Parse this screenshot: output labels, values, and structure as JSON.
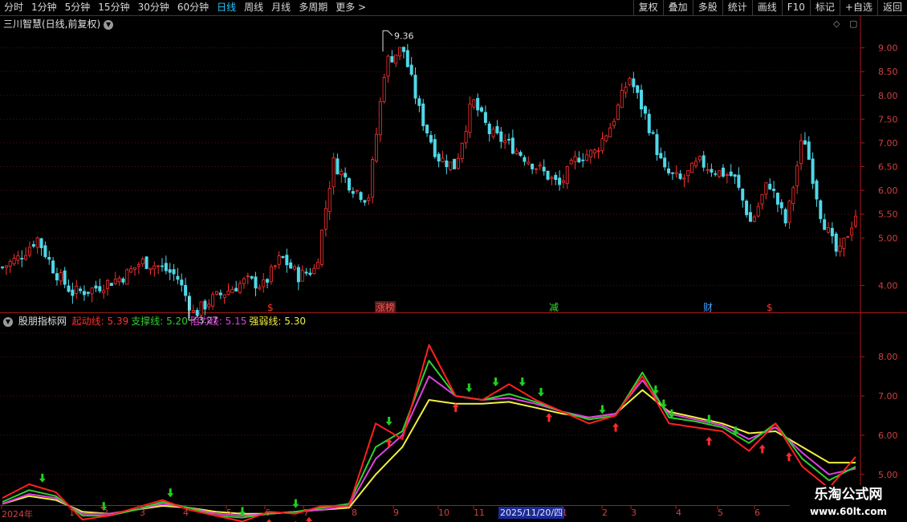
{
  "toolbar": {
    "periods": [
      {
        "label": "分时"
      },
      {
        "label": "1分钟"
      },
      {
        "label": "5分钟"
      },
      {
        "label": "15分钟"
      },
      {
        "label": "30分钟"
      },
      {
        "label": "60分钟"
      },
      {
        "label": "日线"
      },
      {
        "label": "周线"
      },
      {
        "label": "月线"
      },
      {
        "label": "多周期"
      },
      {
        "label": "更多 >"
      }
    ],
    "active_period": "日线",
    "tools": [
      {
        "label": "复权"
      },
      {
        "label": "叠加"
      },
      {
        "label": "多股"
      },
      {
        "label": "统计"
      },
      {
        "label": "画线"
      },
      {
        "label": "F10"
      },
      {
        "label": "标记"
      },
      {
        "label": "+自选"
      },
      {
        "label": "返回"
      }
    ]
  },
  "stock": {
    "title": "三川智慧(日线,前复权)",
    "dropdown_icon": "chevron-down-icon"
  },
  "chart_data": [
    {
      "type": "candlestick",
      "title": "三川智慧(日线,前复权)",
      "y_ticks": [
        "9.00",
        "8.50",
        "8.00",
        "7.50",
        "7.00",
        "6.50",
        "6.00",
        "5.50",
        "5.00",
        "4.00"
      ],
      "ylim": [
        3.5,
        9.5
      ],
      "annotations": [
        {
          "label": "9.36",
          "kind": "high",
          "value": 9.36
        },
        {
          "label": "3.27",
          "kind": "low",
          "value": 3.27
        }
      ],
      "event_markers": [
        {
          "label": "$",
          "color": "#ff3030"
        },
        {
          "label": "涨榜",
          "color": "#ff5050"
        },
        {
          "label": "减",
          "color": "#30e030"
        },
        {
          "label": "财",
          "color": "#40a0ff"
        },
        {
          "label": "$",
          "color": "#ff3030"
        }
      ],
      "colors": {
        "up": "#ff3030",
        "down": "#50d8e8"
      },
      "closes": [
        4.38,
        4.6,
        5.0,
        4.3,
        3.85,
        3.9,
        4.05,
        4.2,
        4.5,
        4.4,
        4.2,
        3.4,
        3.7,
        3.9,
        4.1,
        4.0,
        4.6,
        4.2,
        4.35,
        6.6,
        6.1,
        5.8,
        8.7,
        9.0,
        7.6,
        6.7,
        6.5,
        7.9,
        7.2,
        7.0,
        6.7,
        6.4,
        6.1,
        6.7,
        6.8,
        7.4,
        8.4,
        7.5,
        6.4,
        6.2,
        6.6,
        6.4,
        6.3,
        5.3,
        6.2,
        5.3,
        7.2,
        5.5,
        4.6,
        5.5
      ]
    },
    {
      "type": "line",
      "title": "股朋指标网",
      "y_ticks": [
        "8.00",
        "7.00",
        "6.00",
        "5.00"
      ],
      "ylim": [
        4.3,
        8.7
      ],
      "series": [
        {
          "name": "起动线",
          "current": "5.39",
          "color": "#ff2020",
          "values": [
            4.4,
            4.75,
            4.55,
            3.85,
            3.95,
            4.15,
            4.35,
            4.1,
            3.95,
            3.8,
            4.05,
            4.0,
            4.2,
            4.2,
            6.3,
            5.9,
            8.3,
            7.0,
            6.9,
            7.3,
            6.9,
            6.6,
            6.3,
            6.5,
            7.5,
            6.3,
            6.2,
            6.1,
            5.6,
            6.3,
            5.2,
            4.65,
            5.45
          ]
        },
        {
          "name": "支撑线",
          "current": "5.20",
          "color": "#30d030",
          "values": [
            4.3,
            4.6,
            4.45,
            3.95,
            3.95,
            4.1,
            4.3,
            4.15,
            3.95,
            3.9,
            4.0,
            4.05,
            4.15,
            4.25,
            5.7,
            6.1,
            7.9,
            7.0,
            6.9,
            7.05,
            6.85,
            6.6,
            6.4,
            6.5,
            7.6,
            6.45,
            6.35,
            6.2,
            5.8,
            6.3,
            5.4,
            4.85,
            5.2
          ]
        },
        {
          "name": "阻力线",
          "current": "5.15",
          "color": "#e040e0",
          "values": [
            4.25,
            4.5,
            4.4,
            4.0,
            4.0,
            4.1,
            4.25,
            4.15,
            4.0,
            3.95,
            4.0,
            4.05,
            4.1,
            4.2,
            5.4,
            6.0,
            7.5,
            7.0,
            6.9,
            6.95,
            6.8,
            6.6,
            6.45,
            6.55,
            7.4,
            6.55,
            6.4,
            6.25,
            5.9,
            6.2,
            5.55,
            5.0,
            5.15
          ]
        },
        {
          "name": "强弱线",
          "current": "5.30",
          "color": "#f0f040",
          "values": [
            4.25,
            4.45,
            4.35,
            4.05,
            4.0,
            4.1,
            4.2,
            4.15,
            4.05,
            4.0,
            4.0,
            4.05,
            4.1,
            4.15,
            5.0,
            5.7,
            6.9,
            6.8,
            6.8,
            6.85,
            6.7,
            6.55,
            6.45,
            6.55,
            7.15,
            6.6,
            6.45,
            6.3,
            6.05,
            6.1,
            5.7,
            5.3,
            5.3
          ]
        }
      ],
      "buy_signals": 14,
      "sell_signals": 16,
      "signal_colors": {
        "buy": "#ff2a2a",
        "sell": "#20d020"
      }
    }
  ],
  "indicator": {
    "name": "股朋指标网",
    "labels": [
      {
        "text": "起动线: 5.39",
        "color": "#ff3030"
      },
      {
        "text": "支撑线: 5.20",
        "color": "#30d030"
      },
      {
        "text": "阻力线: 5.15",
        "color": "#e040e0"
      },
      {
        "text": "强弱线: 5.30",
        "color": "#f0f040"
      }
    ]
  },
  "x_axis": {
    "labels": [
      "2024年",
      "1",
      "2",
      "3",
      "4",
      "5",
      "6",
      "7",
      "8",
      "9",
      "10",
      "11",
      "1",
      "2",
      "3",
      "4",
      "5",
      "6"
    ],
    "cursor_date": "2025/11/20/四"
  },
  "watermark": {
    "line1": "乐淘公式网",
    "line2": "www.60lt.com"
  }
}
